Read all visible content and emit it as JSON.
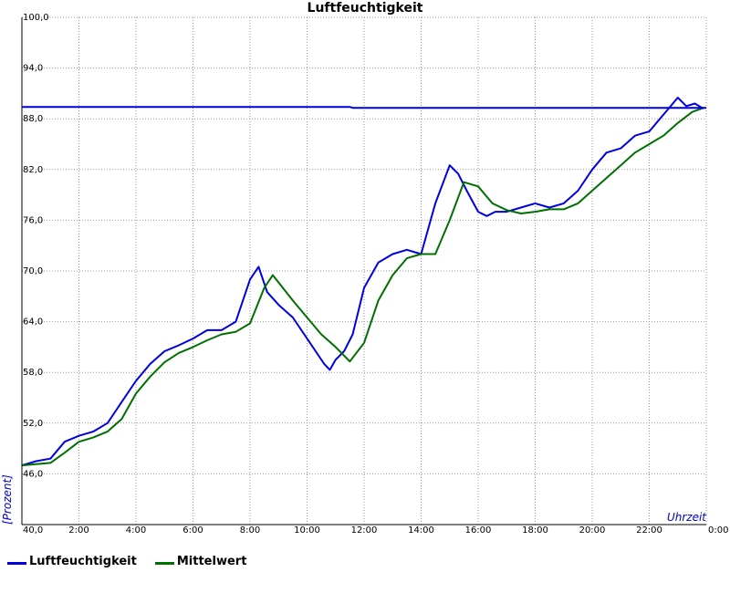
{
  "chart_data": {
    "type": "line",
    "title": "Luftfeuchtigkeit",
    "xlabel": "Uhrzeit",
    "ylabel": "[Prozent]",
    "x_ticks": [
      "2:00",
      "4:00",
      "6:00",
      "8:00",
      "10:00",
      "12:00",
      "14:00",
      "16:00",
      "18:00",
      "20:00",
      "22:00",
      "0:00"
    ],
    "y_ticks": [
      "40,0",
      "46,0",
      "52,0",
      "58,0",
      "64,0",
      "70,0",
      "76,0",
      "82,0",
      "88,0",
      "94,0",
      "100,0"
    ],
    "xlim_hours": [
      0,
      24
    ],
    "ylim": [
      40,
      100
    ],
    "grid": true,
    "legend_position": "bottom-left",
    "series": [
      {
        "name": "Luftfeuchtigkeit",
        "color": "#0000e0",
        "x_hours": [
          0,
          0.5,
          1,
          1.5,
          2,
          2.5,
          3,
          3.5,
          4,
          4.5,
          5,
          5.5,
          6,
          6.5,
          7,
          7.5,
          8,
          8.3,
          8.6,
          9,
          9.5,
          10,
          10.3,
          10.6,
          10.8,
          11,
          11.3,
          11.6,
          12,
          12.5,
          13,
          13.5,
          14,
          14.5,
          15,
          15.3,
          15.6,
          16,
          16.3,
          16.6,
          17,
          17.5,
          18,
          18.5,
          19,
          19.5,
          20,
          20.5,
          21,
          21.5,
          22,
          22.5,
          23,
          23.3,
          23.6,
          23.9
        ],
        "values": [
          47,
          47.5,
          47.8,
          49.8,
          50.5,
          51,
          52,
          54.5,
          57,
          59,
          60.5,
          61.2,
          62,
          63,
          63,
          64,
          69,
          70.5,
          67.5,
          66,
          64.5,
          62,
          60.5,
          59,
          58.3,
          59.5,
          60.5,
          62.5,
          68,
          71,
          72,
          72.5,
          72,
          78,
          82.5,
          81.5,
          79.5,
          77,
          76.5,
          77,
          77,
          77.5,
          78,
          77.5,
          78,
          79.5,
          82,
          84,
          84.5,
          86,
          86.5,
          88.5,
          90.5,
          89.5,
          89.8,
          89.2
        ]
      },
      {
        "name": "Mittelwert",
        "color": "#007000",
        "x_hours": [
          0,
          1,
          1.5,
          2,
          2.5,
          3,
          3.5,
          4,
          4.5,
          5,
          5.5,
          6,
          6.5,
          7,
          7.5,
          8,
          8.5,
          8.8,
          9.5,
          10,
          10.5,
          11,
          11.5,
          12,
          12.5,
          13,
          13.5,
          14,
          14.5,
          15,
          15.5,
          16,
          16.5,
          17,
          17.5,
          18,
          18.5,
          19,
          19.5,
          20,
          20.5,
          21,
          21.5,
          22,
          22.5,
          23,
          23.5,
          23.9
        ],
        "values": [
          47,
          47.3,
          48.5,
          49.8,
          50.3,
          51,
          52.5,
          55.5,
          57.5,
          59.2,
          60.3,
          61,
          61.8,
          62.5,
          62.8,
          63.8,
          68,
          69.5,
          66.5,
          64.5,
          62.5,
          61,
          59.3,
          61.5,
          66.5,
          69.5,
          71.5,
          72,
          72,
          76,
          80.5,
          80,
          78,
          77.2,
          76.8,
          77,
          77.3,
          77.3,
          78,
          79.5,
          81,
          82.5,
          84,
          85,
          86,
          87.5,
          88.8,
          89.3
        ]
      },
      {
        "name": "",
        "color": "#0000e0",
        "x_hours": [
          0,
          11.5,
          11.6,
          24
        ],
        "values": [
          89.4,
          89.4,
          89.3,
          89.3
        ]
      }
    ]
  }
}
